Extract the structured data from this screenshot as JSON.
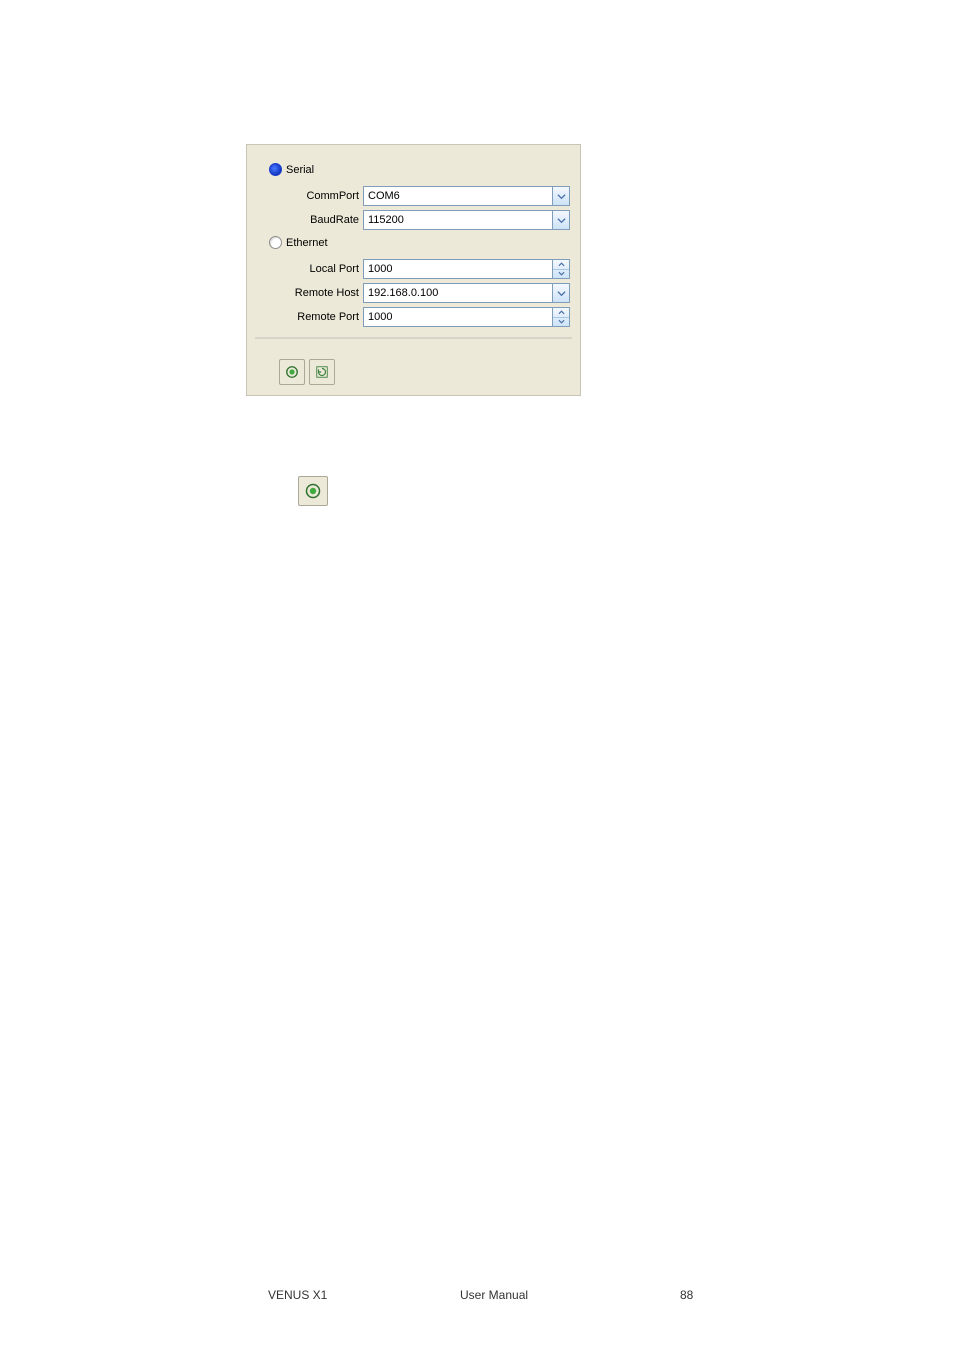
{
  "dialog": {
    "serial": {
      "label": "Serial",
      "selected": true,
      "commport_label": "CommPort",
      "commport_value": "COM6",
      "baudrate_label": "BaudRate",
      "baudrate_value": "115200"
    },
    "ethernet": {
      "label": "Ethernet",
      "selected": false,
      "localport_label": "Local Port",
      "localport_value": "1000",
      "remotehost_label": "Remote Host",
      "remotehost_value": "192.168.0.100",
      "remoteport_label": "Remote Port",
      "remoteport_value": "1000"
    }
  },
  "footer": {
    "left": "VENUS X1",
    "center": "User Manual",
    "right": "88"
  }
}
